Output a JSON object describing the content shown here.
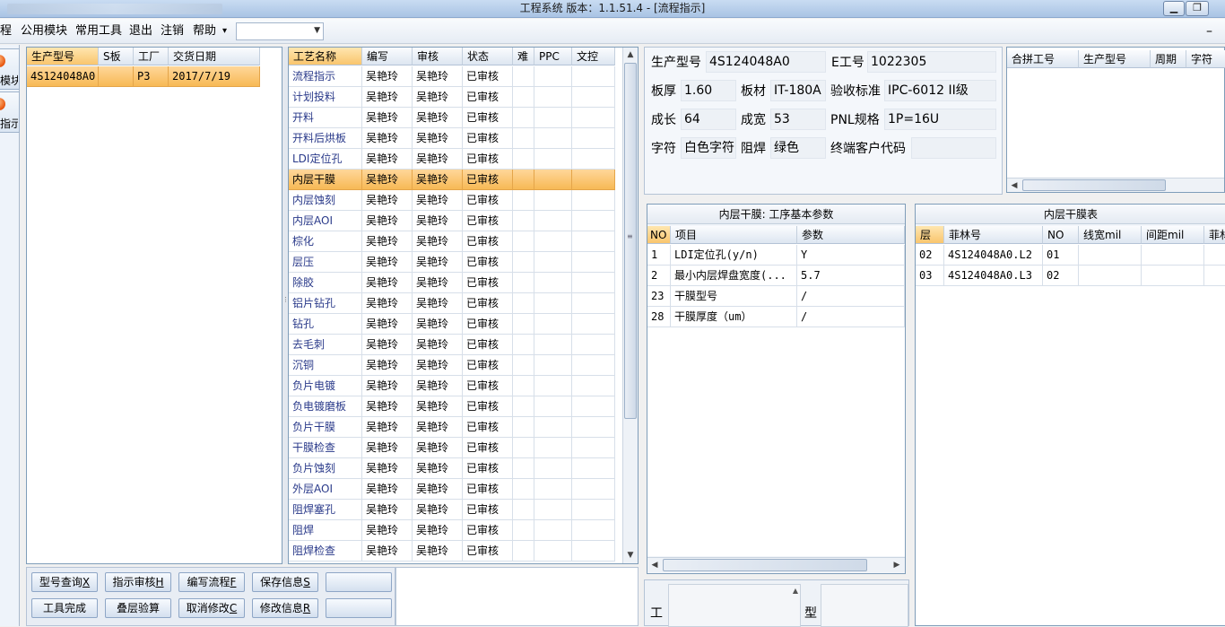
{
  "window": {
    "title": "工程系统   版本：1.1.51.4 - [流程指示]",
    "min_glyph": "▁",
    "restore_glyph": "❐"
  },
  "menu": {
    "items": [
      "程",
      "公用模块",
      "常用工具",
      "退出",
      "注销",
      "帮助"
    ],
    "help_arrow": "▾",
    "combo_value": "",
    "combo_arrow": "▼",
    "right_glyph": "–"
  },
  "strip": {
    "buttons": [
      {
        "label": "模块"
      },
      {
        "label": "指示"
      }
    ]
  },
  "order_grid": {
    "columns": [
      "生产型号",
      "S板",
      "工厂",
      "交货日期"
    ],
    "rows": [
      [
        "4S124048A0",
        "",
        "P3",
        "2017/7/19"
      ]
    ]
  },
  "process_grid": {
    "columns": [
      "工艺名称",
      "编写",
      "审核",
      "状态",
      "难",
      "PPC",
      "文控"
    ],
    "selected_index": 5,
    "rows": [
      [
        "流程指示",
        "吴艳玲",
        "吴艳玲",
        "已审核"
      ],
      [
        "计划投料",
        "吴艳玲",
        "吴艳玲",
        "已审核"
      ],
      [
        "开料",
        "吴艳玲",
        "吴艳玲",
        "已审核"
      ],
      [
        "开料后烘板",
        "吴艳玲",
        "吴艳玲",
        "已审核"
      ],
      [
        "LDI定位孔",
        "吴艳玲",
        "吴艳玲",
        "已审核"
      ],
      [
        "内层干膜",
        "吴艳玲",
        "吴艳玲",
        "已审核"
      ],
      [
        "内层蚀刻",
        "吴艳玲",
        "吴艳玲",
        "已审核"
      ],
      [
        "内层AOI",
        "吴艳玲",
        "吴艳玲",
        "已审核"
      ],
      [
        "棕化",
        "吴艳玲",
        "吴艳玲",
        "已审核"
      ],
      [
        "层压",
        "吴艳玲",
        "吴艳玲",
        "已审核"
      ],
      [
        "除胶",
        "吴艳玲",
        "吴艳玲",
        "已审核"
      ],
      [
        "铝片钻孔",
        "吴艳玲",
        "吴艳玲",
        "已审核"
      ],
      [
        "钻孔",
        "吴艳玲",
        "吴艳玲",
        "已审核"
      ],
      [
        "去毛刺",
        "吴艳玲",
        "吴艳玲",
        "已审核"
      ],
      [
        "沉铜",
        "吴艳玲",
        "吴艳玲",
        "已审核"
      ],
      [
        "负片电镀",
        "吴艳玲",
        "吴艳玲",
        "已审核"
      ],
      [
        "负电镀磨板",
        "吴艳玲",
        "吴艳玲",
        "已审核"
      ],
      [
        "负片干膜",
        "吴艳玲",
        "吴艳玲",
        "已审核"
      ],
      [
        "干膜检查",
        "吴艳玲",
        "吴艳玲",
        "已审核"
      ],
      [
        "负片蚀刻",
        "吴艳玲",
        "吴艳玲",
        "已审核"
      ],
      [
        "外层AOI",
        "吴艳玲",
        "吴艳玲",
        "已审核"
      ],
      [
        "阻焊塞孔",
        "吴艳玲",
        "吴艳玲",
        "已审核"
      ],
      [
        "阻焊",
        "吴艳玲",
        "吴艳玲",
        "已审核"
      ],
      [
        "阻焊检查",
        "吴艳玲",
        "吴艳玲",
        "已审核"
      ]
    ]
  },
  "info": {
    "model_label": "生产型号",
    "model_value": "4S124048A0",
    "eno_label": "E工号",
    "eno_value": "1022305",
    "thick_label": "板厚",
    "thick_value": "1.60",
    "material_label": "板材",
    "material_value": "IT-180A",
    "std_label": "验收标准",
    "std_value": "IPC-6012 II级",
    "len_label": "成长",
    "len_value": "64",
    "width_label": "成宽",
    "width_value": "53",
    "pnl_label": "PNL规格",
    "pnl_value": "1P=16U",
    "char_label": "字符",
    "char_value": "白色字符",
    "mask_label": "阻焊",
    "mask_value": "绿色",
    "cust_label": "终端客户代码",
    "cust_value": ""
  },
  "merge_grid": {
    "columns": [
      "合拼工号",
      "生产型号",
      "周期",
      "字符"
    ]
  },
  "params_panel": {
    "title": "内层干膜: 工序基本参数",
    "columns": [
      "NO",
      "项目",
      "参数"
    ],
    "rows": [
      [
        "1",
        "LDI定位孔(y/n)",
        "Y"
      ],
      [
        "2",
        "最小内层焊盘宽度(...",
        "5.7"
      ],
      [
        "23",
        "干膜型号",
        "/"
      ],
      [
        "28",
        "干膜厚度（um）",
        "/"
      ]
    ]
  },
  "film_panel": {
    "title": "内层干膜表",
    "columns": [
      "层",
      "菲林号",
      "NO",
      "线宽mil",
      "间距mil",
      "菲林"
    ],
    "rows": [
      [
        "02",
        "4S124048A0.L2",
        "01"
      ],
      [
        "03",
        "4S124048A0.L3",
        "02"
      ]
    ]
  },
  "bottom_labels": {
    "left": "工",
    "right": "型"
  },
  "buttons": {
    "row1": [
      {
        "text": "型号查询",
        "key": "X"
      },
      {
        "text": "指示审核",
        "key": "H"
      },
      {
        "text": "编写流程",
        "key": "F"
      },
      {
        "text": "保存信息",
        "key": "S"
      },
      {
        "text": "",
        "key": ""
      }
    ],
    "row2": [
      {
        "text": "工具完成",
        "key": ""
      },
      {
        "text": "叠层验算",
        "key": ""
      },
      {
        "text": "取消修改",
        "key": "C"
      },
      {
        "text": "修改信息",
        "key": "R"
      },
      {
        "text": "",
        "key": ""
      }
    ]
  },
  "scroll_glyphs": {
    "up": "▲",
    "down": "▼",
    "left": "◀",
    "right": "▶"
  }
}
